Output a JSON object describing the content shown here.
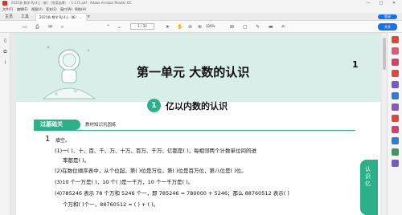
{
  "window": {
    "title": "2021秋·数学·RJ·4上（新）（答案加厚） - 1-171.pdf - Adobe Acrobat Reader DC",
    "controls": [
      "—",
      "□",
      "✕"
    ]
  },
  "menu": [
    "文件(F)",
    "编辑(E)",
    "视图(V)",
    "签名(S)",
    "窗口(W)",
    "帮助(H)"
  ],
  "tabs": {
    "home": "主页",
    "tools": "工具",
    "document": "2021秋·数学·RJ·4上（新）...",
    "document_close": "×",
    "login": "登录"
  },
  "toolbar": {
    "page_current": "1",
    "page_total": "/ 32",
    "zoom": "126%",
    "share": "共享"
  },
  "page": {
    "unit_title": "第一单元   大数的认识",
    "page_number": "1",
    "section_number": "1",
    "section_title": "亿以内数的认识",
    "badge": "过基础关",
    "badge_sub": "教材知识巩固练",
    "question_number": "1",
    "question_title": "填空。",
    "lines": [
      "(1)一(   )、十、百、千、万、十万、百万、千万、亿都是(              )，每相邻两个计数单位间的进",
      "率都是(      )。",
      "(2)在数位顺序表中，从个位起，第(      )位是万位，第(      )位是百万位，第八位是(          )位。",
      "(3)10 个一万是(          )，10 个(          )是一千万，10 个一千万是(          )。",
      "(4)785246 表示 78 个万和 5246 个一，即 785246 = 780000 + 5246；那么 88760512 表示(          )",
      "个万和(          )个一，88760512 = (          ) + (          )。"
    ],
    "side_tab": "认识亿"
  },
  "colors": {
    "accent": "#2bb08a",
    "header_bg": "#d9eee9",
    "acrobat_blue": "#1473e6"
  },
  "icons": {
    "left": [
      "bookmark-icon",
      "pages-icon",
      "attachment-icon"
    ],
    "toolbar": [
      "save-icon",
      "print-icon",
      "mail-icon",
      "search-icon",
      "prev-page-icon",
      "next-page-icon",
      "select-icon",
      "hand-icon",
      "zoom-out-icon",
      "zoom-in-icon",
      "fit-icon",
      "comment-icon",
      "pen-icon",
      "highlight-icon",
      "sign-icon"
    ]
  }
}
